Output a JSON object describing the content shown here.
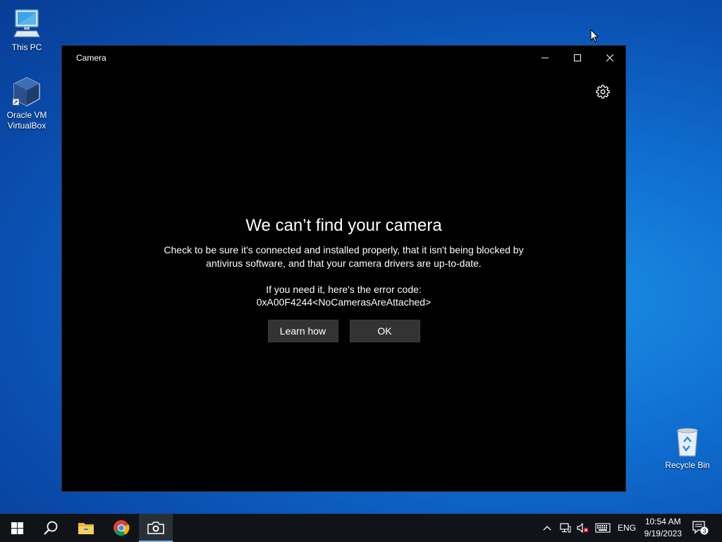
{
  "desktop": {
    "icons": [
      {
        "label": "This PC",
        "icon": "computer-icon"
      },
      {
        "label_line1": "Oracle VM",
        "label_line2": "VirtualBox",
        "icon": "virtualbox-icon"
      },
      {
        "label": "Recycle Bin",
        "icon": "recycle-bin-icon"
      }
    ]
  },
  "window": {
    "title": "Camera",
    "controls": {
      "minimize": "minimize-icon",
      "maximize": "maximize-icon",
      "close": "close-icon"
    },
    "settings_icon": "gear-icon"
  },
  "error": {
    "title": "We can’t find your camera",
    "body": "Check to be sure it's connected and installed properly, that it isn't being blocked by antivirus software, and that your camera drivers are up-to-date.",
    "code_label": "If you need it, here's the error code:",
    "code": "0xA00F4244<NoCamerasAreAttached>",
    "buttons": {
      "learn_how": "Learn how",
      "ok": "OK"
    }
  },
  "taskbar": {
    "items": [
      "windows-start-icon",
      "search-icon",
      "file-explorer-icon",
      "chrome-icon",
      "camera-icon"
    ],
    "active": "camera-icon",
    "tray": {
      "language": "ENG",
      "time": "10:54 AM",
      "date": "9/19/2023",
      "notification_count": "3"
    }
  },
  "colors": {
    "accent": "#76b9ed",
    "window_bg": "#000000",
    "button_bg": "#333333",
    "taskbar_bg": "#101418"
  }
}
